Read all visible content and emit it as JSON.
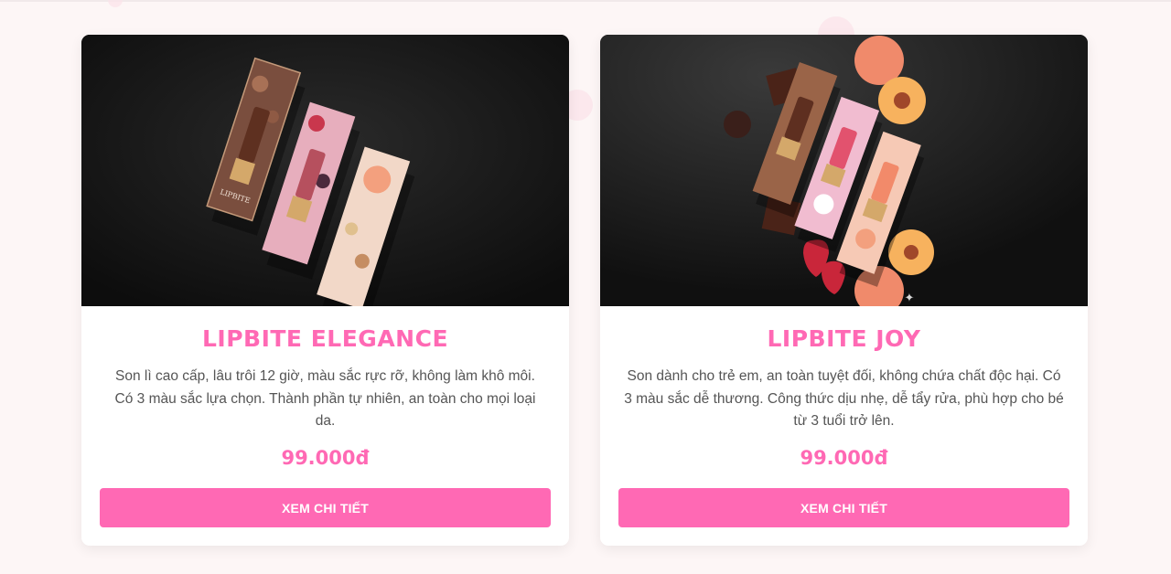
{
  "products": [
    {
      "name": "LIPBITE ELEGANCE",
      "description": "Son lì cao cấp, lâu trôi 12 giờ, màu sắc rực rỡ, không làm khô môi. Có 3 màu sắc lựa chọn. Thành phần tự nhiên, an toàn cho mọi loại da.",
      "price": "99.000đ",
      "button_label": "XEM CHI TIẾT",
      "box_brand_text": "LIPBITE"
    },
    {
      "name": "LIPBITE JOY",
      "description": "Son dành cho trẻ em, an toàn tuyệt đối, không chứa chất độc hại. Có 3 màu sắc dễ thương. Công thức dịu nhẹ, dễ tẩy rửa, phù hợp cho bé từ 3 tuổi trở lên.",
      "price": "99.000đ",
      "button_label": "XEM CHI TIẾT"
    }
  ],
  "colors": {
    "accent": "#ff69b4",
    "page_background": "#fdf6f6",
    "card_background": "#ffffff",
    "text": "#555555"
  }
}
